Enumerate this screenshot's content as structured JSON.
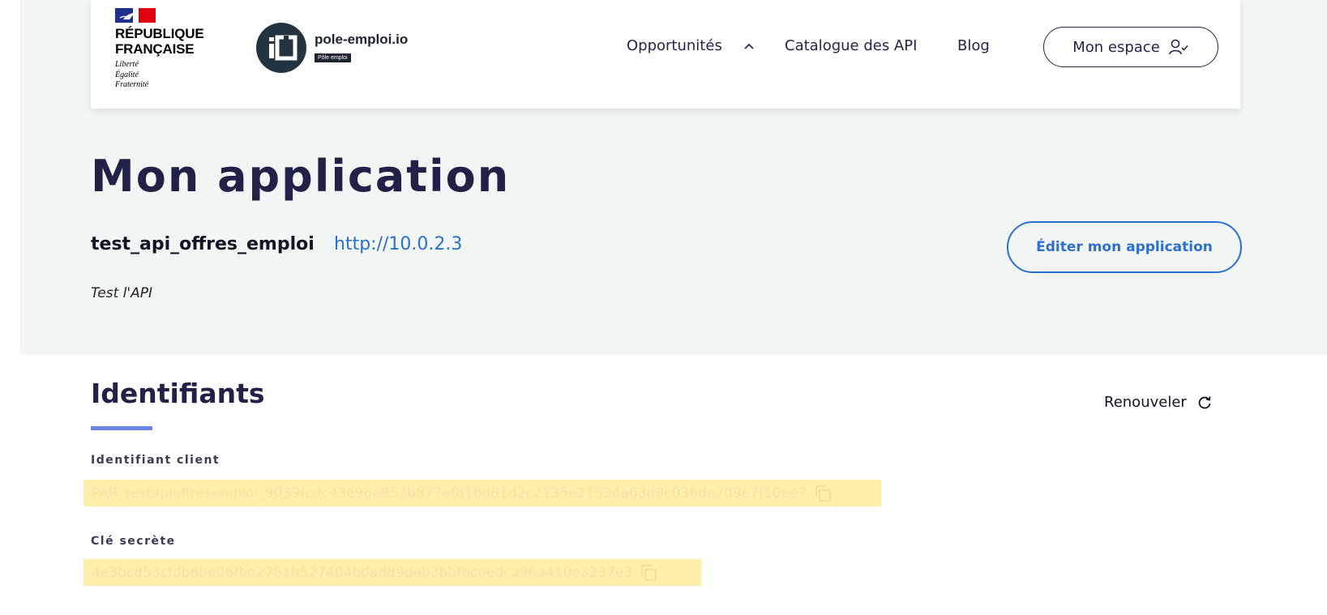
{
  "header": {
    "republic": {
      "line1": "RÉPUBLIQUE",
      "line2": "FRANÇAISE"
    },
    "motto": [
      "Liberté",
      "Égalité",
      "Fraternité"
    ],
    "logo": {
      "name": "pole-emploi.io",
      "badge": "Pôle emploi"
    },
    "nav": [
      {
        "label": "Opportunités",
        "icon": "chevron-up-icon"
      },
      {
        "label": "Catalogue des API"
      },
      {
        "label": "Blog"
      }
    ],
    "account": {
      "label": "Mon espace",
      "icon": "user-check-icon"
    }
  },
  "app": {
    "title": "Mon application",
    "name": "test_api_offres_emploi",
    "url": "http://10.0.2.3",
    "description": "Test l'API",
    "edit_label": "Éditer mon application"
  },
  "credentials": {
    "title": "Identifiants",
    "renew_label": "Renouveler",
    "client_id": {
      "label": "Identifiant client",
      "value": "PAR_testapioffresemploi_9039fcdc43e96e853b877ef816d81d2c2135e21534a63d8c036da709e7f10ee7"
    },
    "secret": {
      "label": "Clé secrète",
      "value": "4e3bc853cfdb6be06fbe2761b527404bdad89deb3bbfbceedca96a410e3237e3"
    }
  },
  "colors": {
    "navy": "#1f2147",
    "link_blue": "#2d6fd1",
    "hero_bg": "#f1f5f4",
    "highlight": "#fdefaa",
    "underline": "#6b86e6"
  }
}
